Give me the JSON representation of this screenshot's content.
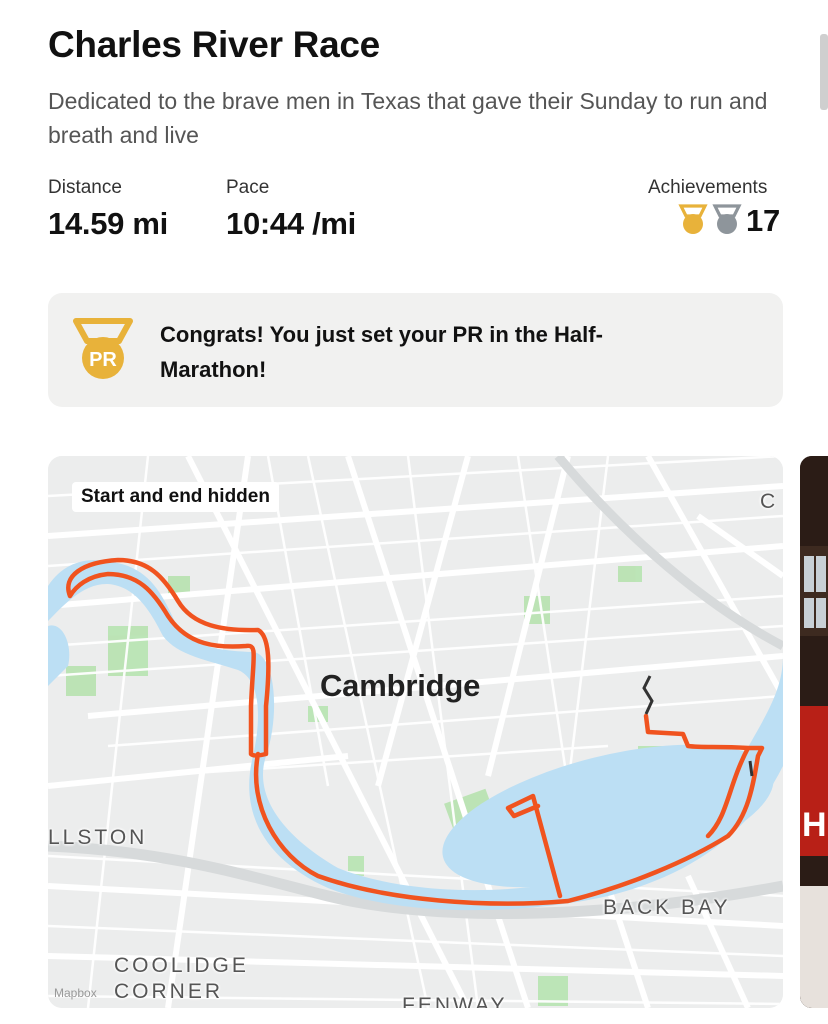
{
  "activity": {
    "title": "Charles River Race",
    "description": "Dedicated to the brave men in Texas that gave their Sunday to run and breath and live"
  },
  "stats": {
    "distance": {
      "label": "Distance",
      "value": "14.59 mi"
    },
    "pace": {
      "label": "Pace",
      "value": "10:44 /mi"
    },
    "achievements": {
      "label": "Achievements",
      "count": "17",
      "icons": [
        "gold-medal-icon",
        "silver-medal-icon"
      ]
    }
  },
  "pr_banner": {
    "badge_text": "PR",
    "message": "Congrats! You just set your PR in the Half-Marathon!"
  },
  "map": {
    "overlay_label": "Start and end hidden",
    "city_label": "Cambridge",
    "neighborhoods": [
      "LLSTON",
      "BACK BAY",
      "COOLIDGE CORNER",
      "FENWAY",
      "C"
    ],
    "attribution": "Mapbox",
    "route_color": "#f0531f"
  },
  "colors": {
    "gold": "#e8b23a",
    "silver": "#8e959b",
    "water": "#bcdff4",
    "park": "#b7e3b0"
  }
}
